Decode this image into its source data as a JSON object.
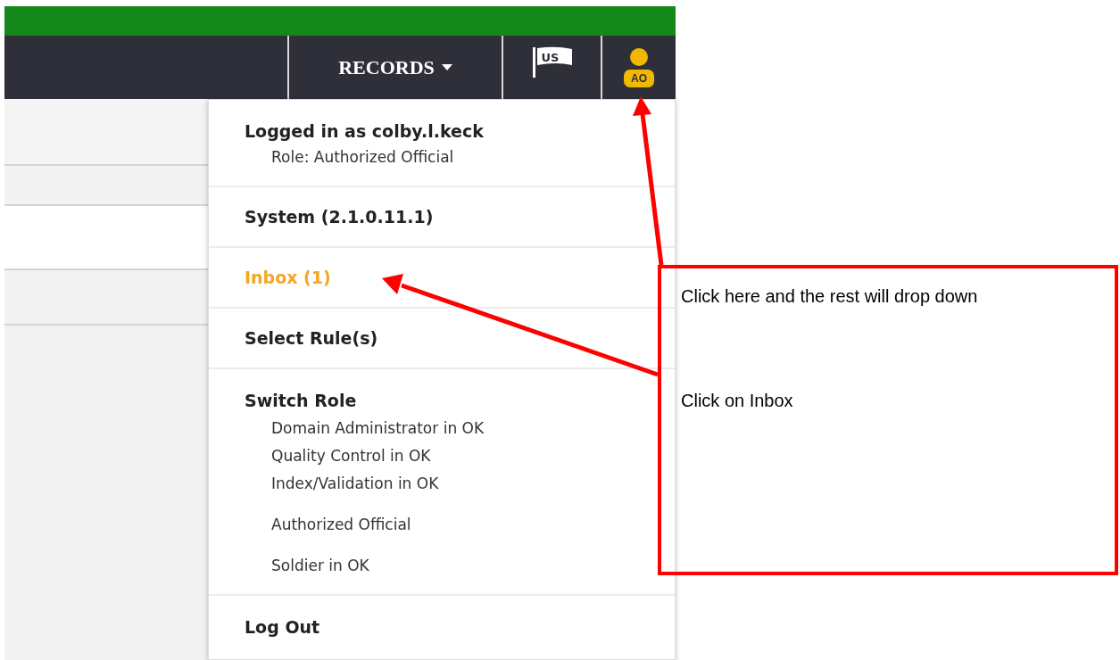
{
  "navbar": {
    "menus": [
      {
        "kind": "dropdown",
        "label": "RECORDS"
      },
      {
        "kind": "flag",
        "label": "US"
      },
      {
        "kind": "user",
        "label": "AO"
      }
    ]
  },
  "user_menu": {
    "logged_in": "Logged in as colby.l.keck",
    "role": "Role: Authorized Official",
    "items": [
      {
        "label": "System (2.1.0.11.1)",
        "highlighted": false
      },
      {
        "label": "Inbox (1)",
        "highlighted": true
      },
      {
        "label": "Select Rule(s)",
        "highlighted": false
      }
    ],
    "switch_role": {
      "title": "Switch Role",
      "roles": [
        "Domain Administrator in OK",
        "Quality Control in OK",
        "Index/Validation in OK",
        "Authorized Official",
        "Soldier in OK"
      ]
    },
    "logout": "Log Out"
  },
  "annotation": {
    "notes": [
      "Click here and the rest will drop down",
      "Click on Inbox"
    ]
  }
}
